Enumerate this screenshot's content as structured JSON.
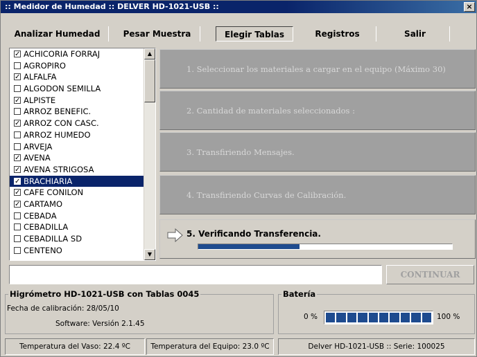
{
  "window": {
    "title": ":: Medidor de Humedad :: DELVER HD-1021-USB ::",
    "close": "×"
  },
  "menu": [
    {
      "label": "Analizar Humedad",
      "active": false
    },
    {
      "label": "Pesar Muestra",
      "active": false
    },
    {
      "label": "Elegir Tablas",
      "active": true
    },
    {
      "label": "Registros",
      "active": false
    },
    {
      "label": "Salir",
      "active": false
    }
  ],
  "materials": [
    {
      "name": "ACHICORIA FORRAJ",
      "checked": true
    },
    {
      "name": "AGROPIRO",
      "checked": false
    },
    {
      "name": "ALFALFA",
      "checked": true
    },
    {
      "name": "ALGODON SEMILLA",
      "checked": false
    },
    {
      "name": "ALPISTE",
      "checked": true
    },
    {
      "name": "ARROZ BENEFIC.",
      "checked": false
    },
    {
      "name": "ARROZ CON CASC.",
      "checked": true
    },
    {
      "name": "ARROZ HUMEDO",
      "checked": false
    },
    {
      "name": "ARVEJA",
      "checked": false
    },
    {
      "name": "AVENA",
      "checked": true
    },
    {
      "name": "AVENA STRIGOSA",
      "checked": true
    },
    {
      "name": "BRACHIARIA",
      "checked": true,
      "selected": true
    },
    {
      "name": "CAFE CONILON",
      "checked": true
    },
    {
      "name": "CARTAMO",
      "checked": true
    },
    {
      "name": "CEBADA",
      "checked": false
    },
    {
      "name": "CEBADILLA",
      "checked": false
    },
    {
      "name": "CEBADILLA SD",
      "checked": false
    },
    {
      "name": "CENTENO",
      "checked": false
    }
  ],
  "steps": [
    "1. Seleccionar los materiales a cargar en el equipo (Máximo 30)",
    "2. Cantidad de materiales seleccionados :",
    "3. Transfiriendo Mensajes.",
    "4. Transfiriendo Curvas de Calibración.",
    "5. Verificando Transferencia."
  ],
  "progress": 0.4,
  "message": "",
  "continue_label": "CONTINUAR",
  "device": {
    "title": "Higrómetro HD-1021-USB con Tablas  0045",
    "calibration": "Fecha de calibración: 28/05/10",
    "software": "Software: Versión 2.1.45"
  },
  "battery": {
    "title": "Batería",
    "min_label": "0 %",
    "max_label": "100 %",
    "level": 1.0,
    "segments": 10
  },
  "status": {
    "vessel_temp": "Temperatura del Vaso: 22.4 ºC",
    "device_temp": "Temperatura del Equipo: 23.0 ºC",
    "serial": "Delver HD-1021-USB :: Serie: 100025"
  },
  "colors": {
    "titlebar": "#0a246a",
    "selection": "#0a246a",
    "progress": "#1e4b8f",
    "step_inactive": "#a0a0a0"
  }
}
